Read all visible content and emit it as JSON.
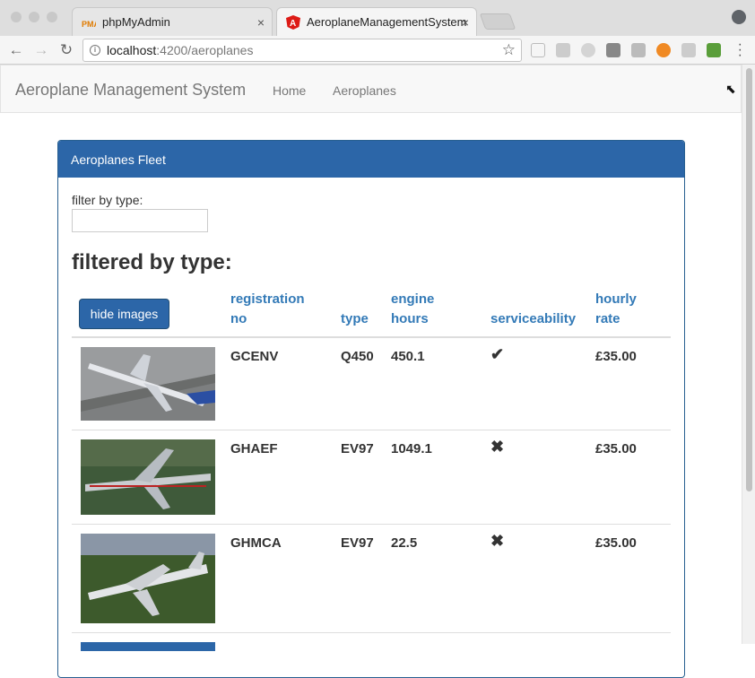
{
  "browser": {
    "tabs": [
      {
        "label": "phpMyAdmin",
        "favicon": "phpmyadmin-icon"
      },
      {
        "label": "AeroplaneManagementSystem",
        "favicon": "angular-icon"
      }
    ],
    "url_host": "localhost",
    "url_path": ":4200/aeroplanes",
    "close_glyph": "×"
  },
  "app": {
    "brand": "Aeroplane Management System",
    "nav": [
      "Home",
      "Aeroplanes"
    ]
  },
  "panel": {
    "heading": "Aeroplanes Fleet",
    "filter_label": "filter by type:",
    "filter_value": "",
    "filtered_title": "filtered by type:",
    "hide_images_label": "hide images"
  },
  "table": {
    "headers": {
      "registration_1": "registration",
      "registration_2": "no",
      "type": "type",
      "engine_1": "engine",
      "engine_2": "hours",
      "serviceability": "serviceability",
      "rate_1": "hourly",
      "rate_2": "rate"
    },
    "rows": [
      {
        "registration": "GCENV",
        "type": "Q450",
        "engine_hours": "450.1",
        "serviceable": "✔",
        "rate": "£35.00"
      },
      {
        "registration": "GHAEF",
        "type": "EV97",
        "engine_hours": "1049.1",
        "serviceable": "✖",
        "rate": "£35.00"
      },
      {
        "registration": "GHMCA",
        "type": "EV97",
        "engine_hours": "22.5",
        "serviceable": "✖",
        "rate": "£35.00"
      }
    ]
  },
  "colors": {
    "primary": "#2c66a8",
    "link": "#337ab7"
  }
}
